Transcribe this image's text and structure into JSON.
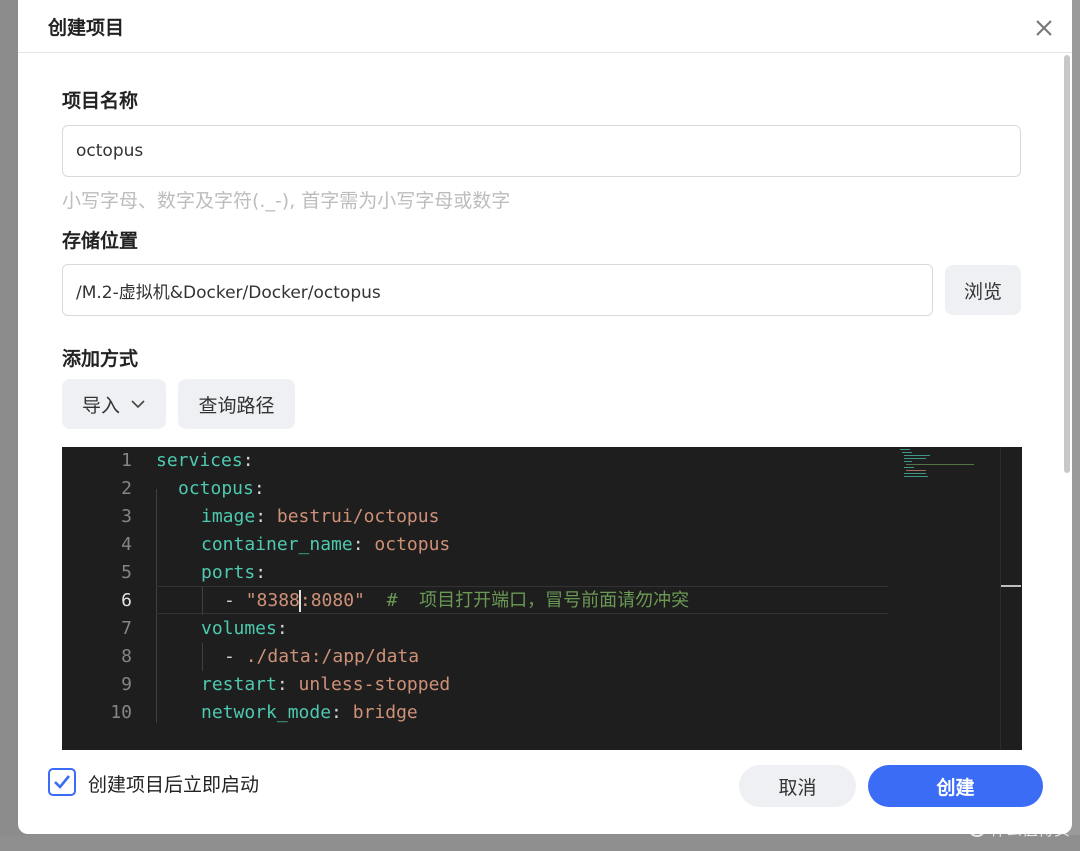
{
  "dialog": {
    "title": "创建项目",
    "close_icon": "close-icon"
  },
  "project_name": {
    "label": "项目名称",
    "value": "octopus",
    "hint": "小写字母、数字及字符(._-), 首字需为小写字母或数字"
  },
  "storage": {
    "label": "存储位置",
    "value": "/M.2-虚拟机&Docker/Docker/octopus",
    "browse_label": "浏览"
  },
  "add_method": {
    "label": "添加方式",
    "import_label": "导入",
    "query_path_label": "查询路径"
  },
  "editor": {
    "line_numbers": [
      "1",
      "2",
      "3",
      "4",
      "5",
      "6",
      "7",
      "8",
      "9",
      "10"
    ],
    "active_line": 6,
    "lines": [
      {
        "key": "services",
        "punct": ":"
      },
      {
        "key": "octopus",
        "punct": ":"
      },
      {
        "key": "image",
        "punct": ": ",
        "value": "bestrui/octopus"
      },
      {
        "key": "container_name",
        "punct": ": ",
        "value": "octopus"
      },
      {
        "key": "ports",
        "punct": ":"
      },
      {
        "dash": "- ",
        "value_a": "\"8388",
        "value_b": ":8080\"",
        "comment": "#  项目打开端口，冒号前面请勿冲突"
      },
      {
        "key": "volumes",
        "punct": ":"
      },
      {
        "dash": "- ",
        "value": "./data:/app/data"
      },
      {
        "key": "restart",
        "punct": ": ",
        "value": "unless-stopped"
      },
      {
        "key": "network_mode",
        "punct": ": ",
        "value": "bridge"
      }
    ]
  },
  "footer": {
    "autostart_label": "创建项目后立即启动",
    "autostart_checked": true,
    "cancel_label": "取消",
    "create_label": "创建"
  },
  "watermark": {
    "text": "什么值得买",
    "badge": "值"
  },
  "colors": {
    "primary": "#3b6cf5",
    "editor_bg": "#1e1e1e",
    "yaml_key": "#4ec9b0",
    "yaml_string": "#ce9178",
    "yaml_comment": "#6a9955"
  }
}
